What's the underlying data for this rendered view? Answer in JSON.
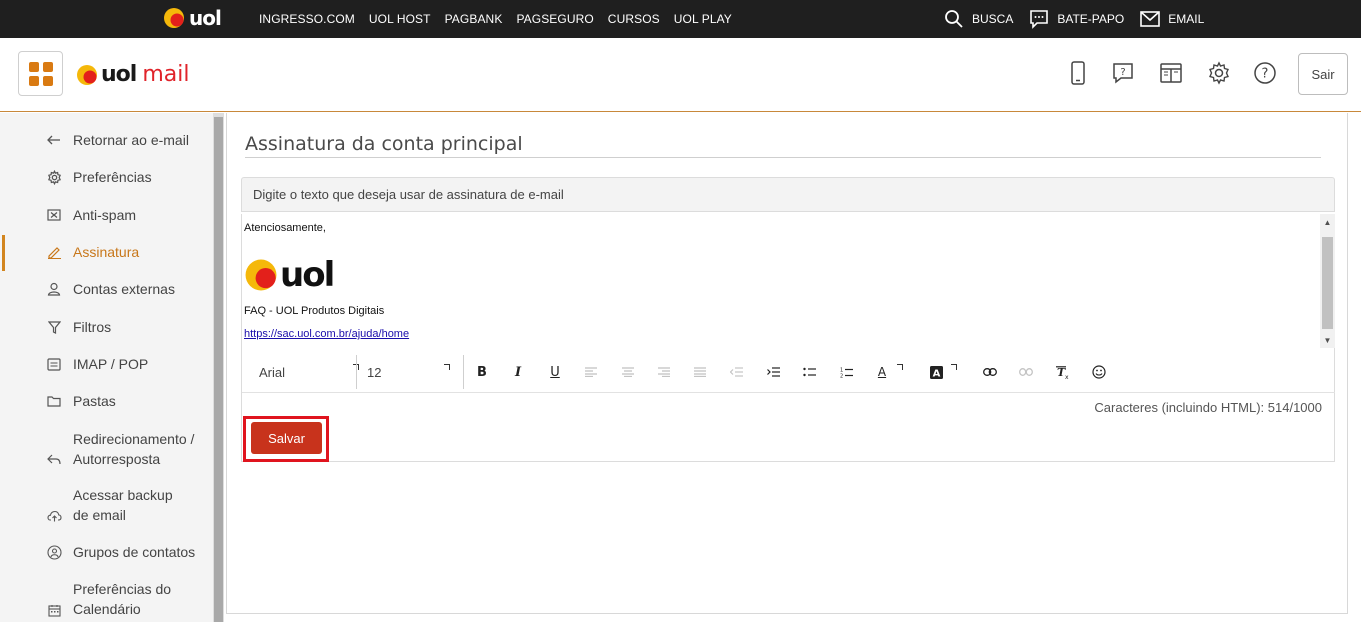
{
  "topbar": {
    "logo_text": "uol",
    "links": [
      "INGRESSO.COM",
      "UOL HOST",
      "PAGBANK",
      "PAGSEGURO",
      "CURSOS",
      "UOL PLAY"
    ],
    "busca": "BUSCA",
    "bate_papo": "BATE-PAPO",
    "email": "EMAIL"
  },
  "header": {
    "brand_uol": "uol",
    "brand_mail": "mail",
    "logout_label": "Sair",
    "icons": [
      "mobile-icon",
      "help-chat-icon",
      "layout-icon",
      "gear-icon",
      "question-icon"
    ]
  },
  "sidebar": {
    "items": [
      {
        "label": "Retornar ao e-mail",
        "icon": "arrow-left-icon"
      },
      {
        "label": "Preferências",
        "icon": "gear-icon"
      },
      {
        "label": "Anti-spam",
        "icon": "antispam-icon"
      },
      {
        "label": "Assinatura",
        "icon": "pen-icon",
        "active": true
      },
      {
        "label": "Contas externas",
        "icon": "user-icon"
      },
      {
        "label": "Filtros",
        "icon": "filter-icon"
      },
      {
        "label": "IMAP / POP",
        "icon": "imap-icon"
      },
      {
        "label": "Pastas",
        "icon": "folder-icon"
      },
      {
        "label_line1": "Redirecionamento /",
        "label_line2": "Autorresposta",
        "icon": "reply-icon"
      },
      {
        "label_line1": "Acessar backup",
        "label_line2": "de email",
        "icon": "cloud-icon"
      },
      {
        "label": "Grupos de contatos",
        "icon": "group-icon"
      },
      {
        "label_line1": "Preferências do",
        "label_line2": "Calendário",
        "icon": "calendar-icon"
      }
    ]
  },
  "main": {
    "title": "Assinatura da conta principal",
    "hint": "Digite o texto que deseja usar de assinatura de e-mail",
    "editor": {
      "greeting": "Atenciosamente,",
      "logo_text": "uol",
      "faq": "FAQ - UOL Produtos Digitais",
      "link": "https://sac.uol.com.br/ajuda/home"
    },
    "toolbar": {
      "font": "Arial",
      "size": "12"
    },
    "char_count": "Caracteres (incluindo HTML): 514/1000",
    "save_label": "Salvar"
  },
  "colors": {
    "accent": "#d2851f",
    "save": "#c8331c",
    "brand_red": "#e0232a"
  }
}
